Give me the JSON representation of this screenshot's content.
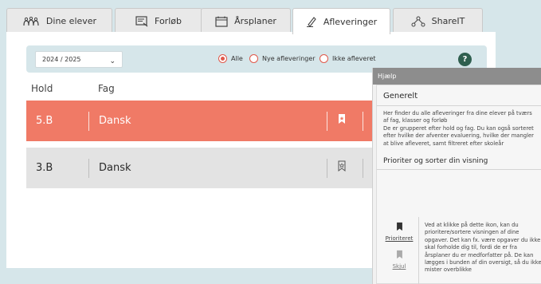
{
  "tabs": [
    {
      "label": "Dine elever",
      "icon": "students-icon"
    },
    {
      "label": "Forløb",
      "icon": "course-icon"
    },
    {
      "label": "Årsplaner",
      "icon": "calendar-icon"
    },
    {
      "label": "Afleveringer",
      "icon": "pen-icon",
      "active": true
    },
    {
      "label": "ShareIT",
      "icon": "share-icon"
    }
  ],
  "filters": {
    "year": "2024 / 2025",
    "options": [
      "Alle",
      "Nye afleveringer",
      "Ikke afleveret"
    ],
    "selected": "Alle",
    "help_label": "?"
  },
  "columns": {
    "hold": "Hold",
    "fag": "Fag"
  },
  "rows": [
    {
      "hold": "5.B",
      "fag": "Dansk",
      "prioritized": true
    },
    {
      "hold": "3.B",
      "fag": "Dansk",
      "prioritized": false
    }
  ],
  "help": {
    "header": "Hjælp",
    "section1_title": "Generelt",
    "section1_text": "Her finder du alle afleveringer fra dine elever på tværs af fag, klasser og forløb\nDe er grupperet efter hold og fag. Du kan også sorteret efter hvilke der afventer evaluering, hvilke der mangler at blive afleveret, samt filtreret efter skoleår",
    "section2_title": "Prioriter og sorter din visning",
    "prioritize_label": "Prioriteret",
    "hide_label": "Skjul",
    "section2_text": "Ved at klikke på dette ikon, kan du prioritere/sortere visningen af dine opgaver. Det kan fx. være opgaver du ikke skal forholde dig til, fordi de er fra årsplaner du er medforfatter på. De kan lægges i bunden af din oversigt, så du ikke mister overblikke"
  },
  "colors": {
    "accent": "#f07a66",
    "background": "#d6e6ea",
    "help_button": "#2f5f4f"
  }
}
